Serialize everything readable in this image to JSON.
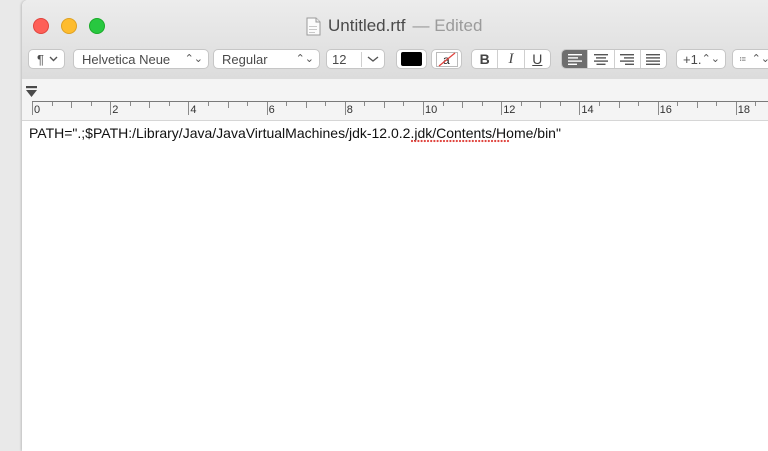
{
  "window": {
    "title": "Untitled.rtf",
    "status": "— Edited"
  },
  "toolbar": {
    "paragraph_style_icon": "pilcrow-icon",
    "font_family": "Helvetica Neue",
    "font_typeface": "Regular",
    "font_size": "12",
    "text_color": "#000000",
    "bold": "B",
    "italic": "I",
    "underline": "U",
    "alignment_selected": "left",
    "line_spacing": "+1...",
    "list_icon": "list-bullets-icon"
  },
  "ruler": {
    "labels": [
      "0",
      "2",
      "4",
      "6",
      "8",
      "10",
      "12",
      "14",
      "16",
      "18"
    ]
  },
  "document": {
    "text": "PATH=\".;$PATH:/Library/Java/JavaVirtualMachines/jdk-12.0.2.jdk/Contents/Home/bin\"",
    "misspelled_word": "jdk-12.0.2.jdk"
  },
  "colors": {
    "close": "#fe5f57",
    "minimize": "#febc2e",
    "maximize": "#28c840",
    "active_alignment": "#6e6e6e",
    "spelling_underline": "#e0443e"
  }
}
